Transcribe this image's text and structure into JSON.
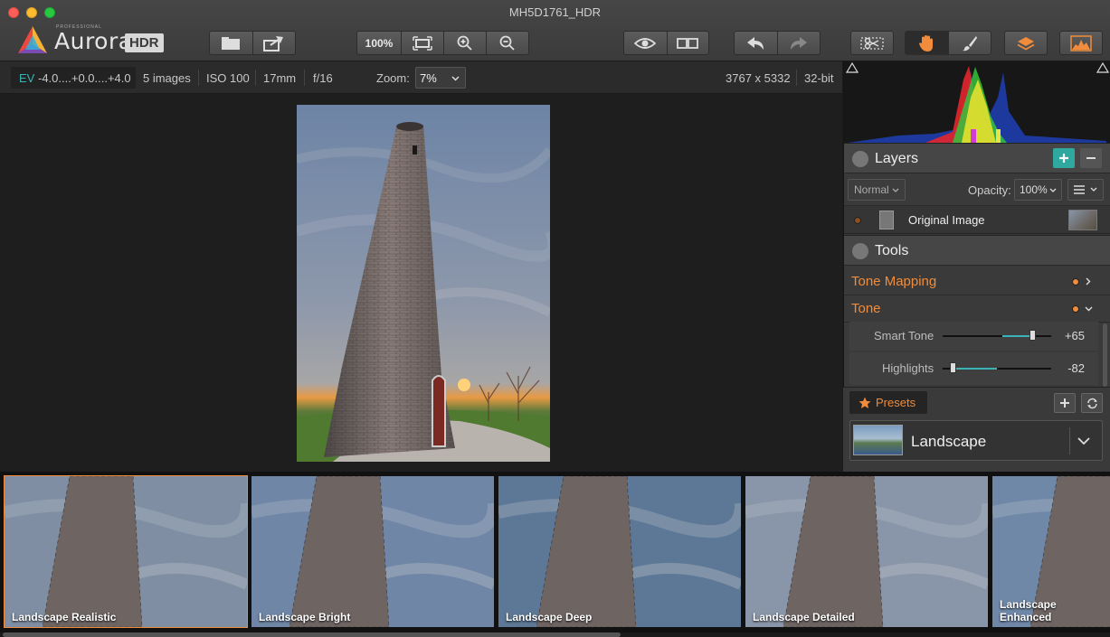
{
  "window": {
    "title": "MH5D1761_HDR"
  },
  "logo": {
    "small": "PROFESSIONAL",
    "name": "Aurora",
    "badge": "HDR"
  },
  "toolbar": {
    "zoom_label": "100%"
  },
  "info": {
    "ev_prefix": "EV",
    "ev_range": "-4.0....+0.0....+4.0",
    "images": "5 images",
    "iso": "ISO 100",
    "focal": "17mm",
    "aperture": "f/16",
    "zoom_label": "Zoom:",
    "zoom_value": "7%",
    "dimensions": "3767 x 5332",
    "bitdepth": "32-bit"
  },
  "layers": {
    "title": "Layers",
    "blend_mode": "Normal",
    "opacity_label": "Opacity:",
    "opacity_value": "100%",
    "items": [
      {
        "name": "Original Image"
      }
    ]
  },
  "tools": {
    "title": "Tools",
    "sections": [
      {
        "name": "Tone Mapping",
        "expanded": false
      },
      {
        "name": "Tone",
        "expanded": true
      }
    ],
    "sliders": [
      {
        "label": "Smart Tone",
        "value": "+65",
        "level": 0.825
      },
      {
        "label": "Highlights",
        "value": "-82",
        "level": 0.09
      }
    ]
  },
  "presets": {
    "button_label": "Presets",
    "category": "Landscape",
    "items": [
      {
        "name": "Landscape Realistic",
        "selected": true
      },
      {
        "name": "Landscape Bright",
        "selected": false
      },
      {
        "name": "Landscape Deep",
        "selected": false
      },
      {
        "name": "Landscape Detailed",
        "selected": false
      },
      {
        "name": "Landscape Enhanced",
        "selected": false
      }
    ]
  },
  "colors": {
    "accent": "#f08c3c",
    "teal": "#3ab3b8",
    "add_button": "#2fa8a0"
  }
}
